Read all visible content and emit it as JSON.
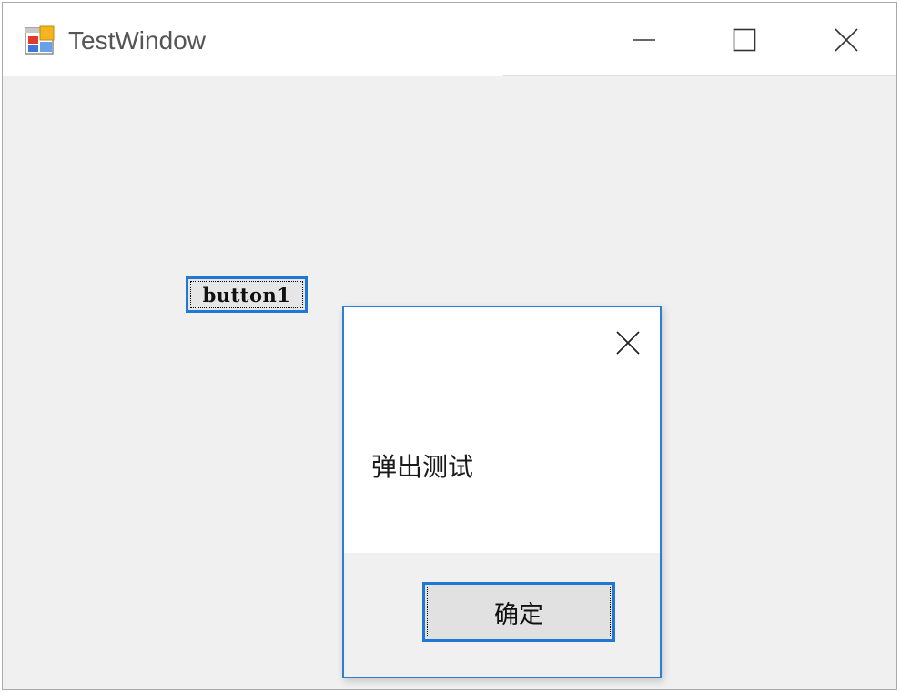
{
  "window": {
    "title": "TestWindow",
    "icon": "app-window-icon",
    "caption_buttons": [
      "minimize-icon",
      "maximize-icon",
      "close-icon"
    ]
  },
  "form": {
    "button1_label": "button1"
  },
  "messagebox": {
    "message": "弹出测试",
    "ok_label": "确定",
    "close_icon": "close-icon"
  },
  "colors": {
    "focus_border": "#1e78d4",
    "dialog_border": "#2b7fd6",
    "client_bg": "#f0f0f0"
  }
}
